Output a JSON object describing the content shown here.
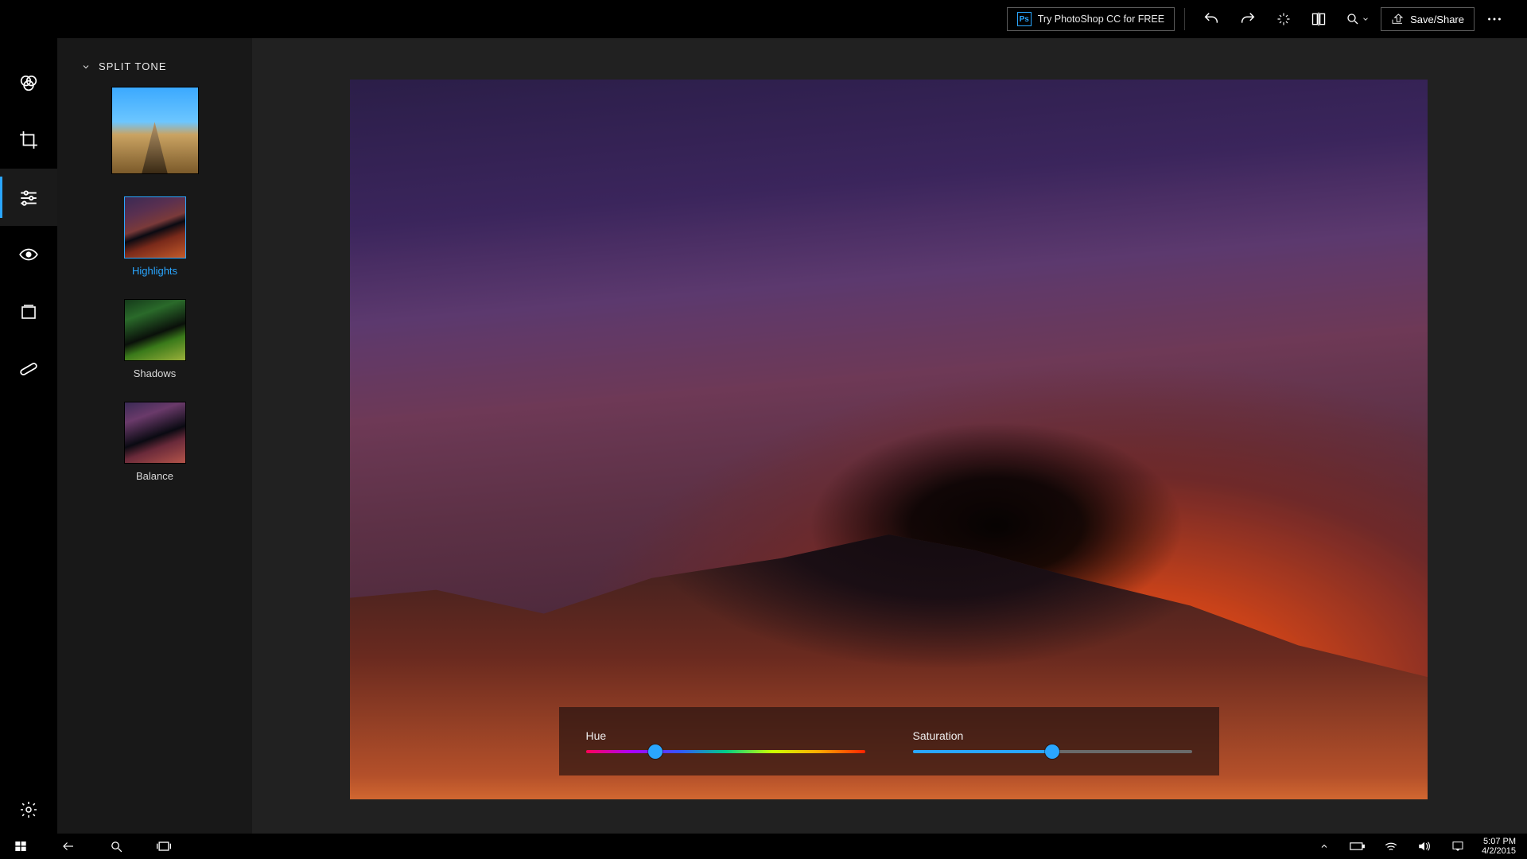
{
  "topbar": {
    "try_ps_label": "Try PhotoShop CC for FREE",
    "try_ps_badge": "Ps",
    "save_share_label": "Save/Share"
  },
  "toolrail": {
    "items": [
      {
        "name": "color-adjust",
        "active": false
      },
      {
        "name": "crop",
        "active": false
      },
      {
        "name": "sliders",
        "active": true
      },
      {
        "name": "eye",
        "active": false
      },
      {
        "name": "frame",
        "active": false
      },
      {
        "name": "heal",
        "active": false
      }
    ],
    "settings_name": "settings"
  },
  "panel": {
    "header": "SPLIT TONE",
    "presets": [
      {
        "key": "original",
        "label": "",
        "selected": false,
        "thumb": "sky",
        "big": true
      },
      {
        "key": "highlights",
        "label": "Highlights",
        "selected": true,
        "thumb": "highlights"
      },
      {
        "key": "shadows",
        "label": "Shadows",
        "selected": false,
        "thumb": "shadows"
      },
      {
        "key": "balance",
        "label": "Balance",
        "selected": false,
        "thumb": "balance"
      }
    ]
  },
  "sliders": {
    "hue": {
      "label": "Hue",
      "value_pct": 25
    },
    "saturation": {
      "label": "Saturation",
      "value_pct": 50
    }
  },
  "taskbar": {
    "time": "5:07 PM",
    "date": "4/2/2015"
  }
}
